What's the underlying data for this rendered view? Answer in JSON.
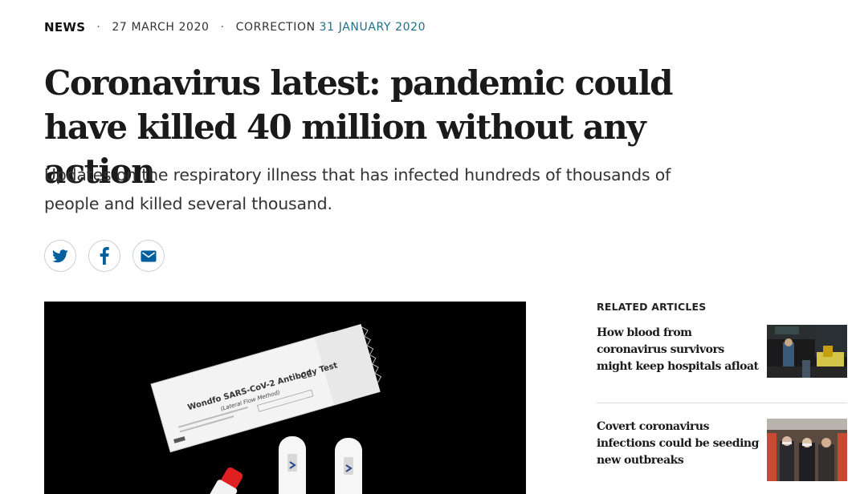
{
  "meta": {
    "type": "NEWS",
    "separator": "·",
    "date": "27 MARCH 2020",
    "correction_label": "CORRECTION",
    "correction_date": "31 JANUARY 2020"
  },
  "headline": "Coronavirus latest: pandemic could have killed 40 million without any action",
  "standfirst": "Updates on the respiratory illness that has infected hundreds of thousands of people and killed several thousand.",
  "share": {
    "icons": [
      "twitter-icon",
      "facebook-icon",
      "email-icon"
    ],
    "color": "#005f9e"
  },
  "hero_image": {
    "package_text": "Wondfo SARS-CoV-2 Antibody Test",
    "package_subtext": "(Lateral Flow Method)",
    "ce_mark": "CE"
  },
  "related": {
    "title": "RELATED ARTICLES",
    "items": [
      {
        "title": "How blood from coronavirus survivors might keep hospitals afloat"
      },
      {
        "title": "Covert coronavirus infections could be seeding new outbreaks"
      }
    ]
  },
  "colors": {
    "link_blue": "#1f6e8c",
    "icon_blue": "#005f9e",
    "hero_bg": "#000000"
  }
}
